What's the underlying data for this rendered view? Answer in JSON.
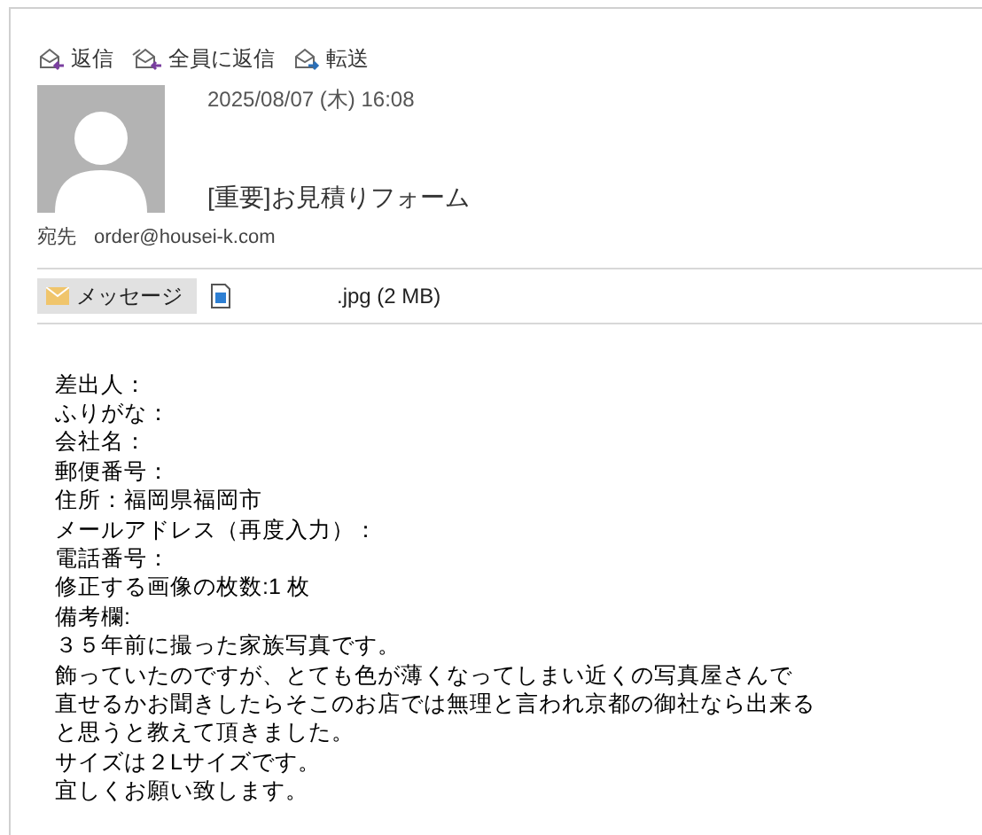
{
  "actions": [
    {
      "label": "返信",
      "kind": "reply"
    },
    {
      "label": "全員に返信",
      "kind": "reply_all"
    },
    {
      "label": "転送",
      "kind": "forward"
    }
  ],
  "message": {
    "date": "2025/08/07 (木) 16:08",
    "subject": "[重要]お見積りフォーム",
    "to_label": "宛先",
    "to": "order@housei-k.com"
  },
  "attachments": [
    {
      "kind": "message",
      "label": "メッセージ",
      "selected": true
    },
    {
      "kind": "file",
      "label": ".jpg (2 MB)",
      "selected": false
    }
  ],
  "body": [
    "差出人：",
    "ふりがな：",
    "会社名：",
    "郵便番号：",
    "住所：福岡県福岡市",
    "メールアドレス（再度入力）：",
    "電話番号：",
    "修正する画像の枚数:1 枚",
    "備考欄:",
    "３５年前に撮った家族写真です。",
    "飾っていたのですが、とても色が薄くなってしまい近くの写真屋さんで",
    "直せるかお聞きしたらそこのお店では無理と言われ京都の御社なら出来る",
    "と思うと教えて頂きました。",
    "サイズは２Lサイズです。",
    "宜しくお願い致します。"
  ]
}
